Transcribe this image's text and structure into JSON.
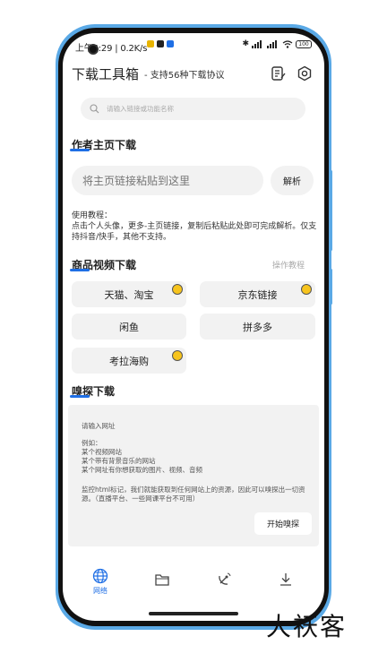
{
  "status_bar": {
    "time_speed": "上午5:29 | 0.2K/s",
    "battery": "100"
  },
  "header": {
    "title": "下载工具箱",
    "subtitle": "- 支持56种下载协议"
  },
  "search": {
    "placeholder": "请输入链接或功能名称"
  },
  "author_section": {
    "title": "作者主页下载",
    "input_placeholder": "将主页链接粘贴到这里",
    "parse_label": "解析",
    "hint": "使用教程：\n点击个人头像，更多-主页链接，复制后粘贴此处即可完成解析。仅支持抖音/快手，其他不支持。"
  },
  "product_section": {
    "title": "商品视频下载",
    "help_label": "操作教程",
    "buttons": [
      "天猫、淘宝",
      "京东链接",
      "闲鱼",
      "拼多多",
      "考拉海购"
    ]
  },
  "sniff_section": {
    "title": "嗅探下载",
    "line1": "请输入网址",
    "line2": "例如：\n某个视频网站\n某个带有背景音乐的网站\n某个网址有你想获取的图片、视频、音频",
    "line3": "监控html标记，我们就能获取到任何网站上的资源，因此可以嗅探出一切资源。（直播平台、一些网课平台不可用）",
    "start_label": "开始嗅探"
  },
  "tabbar": {
    "tabs": [
      {
        "label": "网络",
        "icon": "globe-icon",
        "active": true
      },
      {
        "label": "",
        "icon": "folder-icon",
        "active": false
      },
      {
        "label": "",
        "icon": "satellite-icon",
        "active": false
      },
      {
        "label": "",
        "icon": "download-icon",
        "active": false
      }
    ]
  },
  "watermark": "大祆客",
  "colors": {
    "accent": "#1f6fe5",
    "frame": "#5aa9e6",
    "card_bg": "#f2f2f2",
    "badge": "#f7c41d"
  }
}
